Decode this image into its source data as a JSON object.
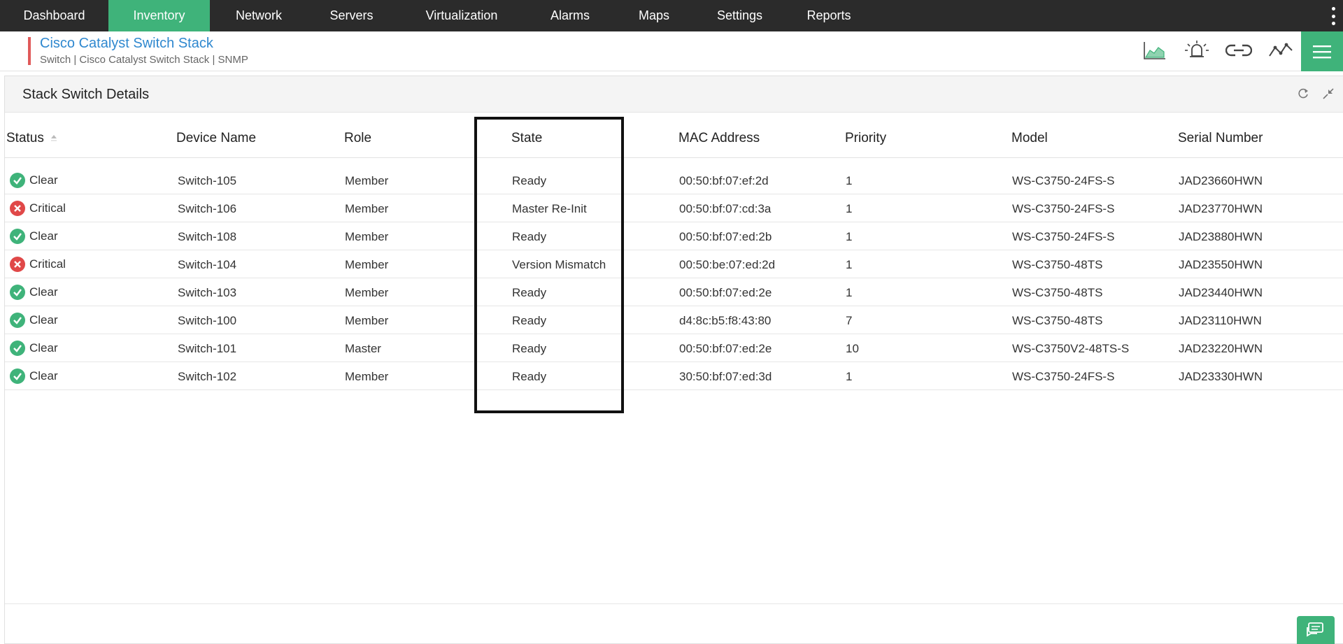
{
  "nav": {
    "items": [
      {
        "label": "Dashboard",
        "active": false
      },
      {
        "label": "Inventory",
        "active": true
      },
      {
        "label": "Network",
        "active": false
      },
      {
        "label": "Servers",
        "active": false
      },
      {
        "label": "Virtualization",
        "active": false
      },
      {
        "label": "Alarms",
        "active": false
      },
      {
        "label": "Maps",
        "active": false
      },
      {
        "label": "Settings",
        "active": false
      },
      {
        "label": "Reports",
        "active": false
      }
    ],
    "more_icon": "kebab-menu-icon"
  },
  "device": {
    "title": "Cisco Catalyst Switch Stack",
    "subtitle": "Switch | Cisco Catalyst Switch Stack  | SNMP",
    "accent_color": "#e05a5a",
    "icons": [
      "area-chart-icon",
      "alarm-bell-icon",
      "link-icon",
      "trend-line-icon",
      "hamburger-menu-icon"
    ]
  },
  "panel": {
    "title": "Stack Switch Details",
    "tools": [
      "refresh-icon",
      "collapse-icon"
    ]
  },
  "table": {
    "columns": [
      "Status",
      "Device Name",
      "Role",
      "State",
      "MAC Address",
      "Priority",
      "Model",
      "Serial Number"
    ],
    "sorted_column": "Status",
    "rows": [
      {
        "status": "Clear",
        "status_type": "ok",
        "device": "Switch-105",
        "role": "Member",
        "state": "Ready",
        "mac": "00:50:bf:07:ef:2d",
        "priority": "1",
        "model": "WS-C3750-24FS-S",
        "serial": "JAD23660HWN"
      },
      {
        "status": "Critical",
        "status_type": "crit",
        "device": "Switch-106",
        "role": "Member",
        "state": "Master Re-Init",
        "mac": "00:50:bf:07:cd:3a",
        "priority": "1",
        "model": "WS-C3750-24FS-S",
        "serial": "JAD23770HWN"
      },
      {
        "status": "Clear",
        "status_type": "ok",
        "device": "Switch-108",
        "role": "Member",
        "state": "Ready",
        "mac": "00:50:bf:07:ed:2b",
        "priority": "1",
        "model": "WS-C3750-24FS-S",
        "serial": "JAD23880HWN"
      },
      {
        "status": "Critical",
        "status_type": "crit",
        "device": "Switch-104",
        "role": "Member",
        "state": "Version Mismatch",
        "mac": "00:50:be:07:ed:2d",
        "priority": "1",
        "model": "WS-C3750-48TS",
        "serial": "JAD23550HWN"
      },
      {
        "status": "Clear",
        "status_type": "ok",
        "device": "Switch-103",
        "role": "Member",
        "state": "Ready",
        "mac": "00:50:bf:07:ed:2e",
        "priority": "1",
        "model": "WS-C3750-48TS",
        "serial": "JAD23440HWN"
      },
      {
        "status": "Clear",
        "status_type": "ok",
        "device": "Switch-100",
        "role": "Member",
        "state": "Ready",
        "mac": "d4:8c:b5:f8:43:80",
        "priority": "7",
        "model": "WS-C3750-48TS",
        "serial": "JAD23110HWN"
      },
      {
        "status": "Clear",
        "status_type": "ok",
        "device": "Switch-101",
        "role": "Master",
        "state": "Ready",
        "mac": "00:50:bf:07:ed:2e",
        "priority": "10",
        "model": "WS-C3750V2-48TS-S",
        "serial": "JAD23220HWN"
      },
      {
        "status": "Clear",
        "status_type": "ok",
        "device": "Switch-102",
        "role": "Member",
        "state": "Ready",
        "mac": "30:50:bf:07:ed:3d",
        "priority": "1",
        "model": "WS-C3750-24FS-S",
        "serial": "JAD23330HWN"
      }
    ]
  },
  "colors": {
    "accent_green": "#3fb37a",
    "critical_red": "#e04848",
    "link_blue": "#2f88cf",
    "nav_bg": "#2b2b2b"
  },
  "chat_icon": "chat-icon"
}
